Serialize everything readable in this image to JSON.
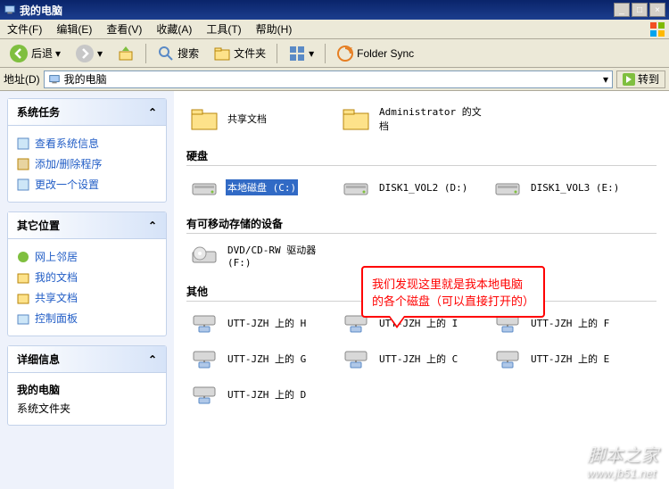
{
  "window": {
    "title": "我的电脑",
    "buttons": {
      "min": "_",
      "max": "□",
      "close": "×"
    }
  },
  "menu": {
    "file": "文件(F)",
    "edit": "编辑(E)",
    "view": "查看(V)",
    "favorites": "收藏(A)",
    "tools": "工具(T)",
    "help": "帮助(H)"
  },
  "toolbar": {
    "back": "后退",
    "search": "搜索",
    "folders": "文件夹",
    "folder_sync": "Folder Sync"
  },
  "address": {
    "label": "地址(D)",
    "value": "我的电脑",
    "go": "转到"
  },
  "sidebar": {
    "system_tasks": {
      "title": "系统任务",
      "items": [
        "查看系统信息",
        "添加/删除程序",
        "更改一个设置"
      ]
    },
    "other_places": {
      "title": "其它位置",
      "items": [
        "网上邻居",
        "我的文档",
        "共享文档",
        "控制面板"
      ]
    },
    "details": {
      "title": "详细信息",
      "name": "我的电脑",
      "type": "系统文件夹"
    }
  },
  "content": {
    "top_items": [
      {
        "label": "共享文档",
        "icon": "folder"
      },
      {
        "label": "Administrator 的文档",
        "icon": "folder"
      }
    ],
    "sections": {
      "hdd": {
        "title": "硬盘",
        "items": [
          {
            "label": "本地磁盘 (C:)",
            "icon": "hdd",
            "selected": true
          },
          {
            "label": "DISK1_VOL2 (D:)",
            "icon": "hdd"
          },
          {
            "label": "DISK1_VOL3 (E:)",
            "icon": "hdd"
          }
        ]
      },
      "removable": {
        "title": "有可移动存储的设备",
        "items": [
          {
            "label": "DVD/CD-RW 驱动器 (F:)",
            "icon": "cd"
          }
        ]
      },
      "other": {
        "title": "其他",
        "items": [
          {
            "label": "UTT-JZH 上的 H",
            "icon": "netdrive"
          },
          {
            "label": "UTT-JZH 上的 I",
            "icon": "netdrive"
          },
          {
            "label": "UTT-JZH 上的 F",
            "icon": "netdrive"
          },
          {
            "label": "UTT-JZH 上的 G",
            "icon": "netdrive"
          },
          {
            "label": "UTT-JZH 上的 C",
            "icon": "netdrive"
          },
          {
            "label": "UTT-JZH 上的 E",
            "icon": "netdrive"
          },
          {
            "label": "UTT-JZH 上的 D",
            "icon": "netdrive"
          }
        ]
      }
    }
  },
  "callout": {
    "line1": "我们发现这里就是我本地电脑",
    "line2": "的各个磁盘（可以直接打开的）"
  },
  "watermark": {
    "line1": "脚本之家",
    "line2": "www.jb51.net"
  }
}
